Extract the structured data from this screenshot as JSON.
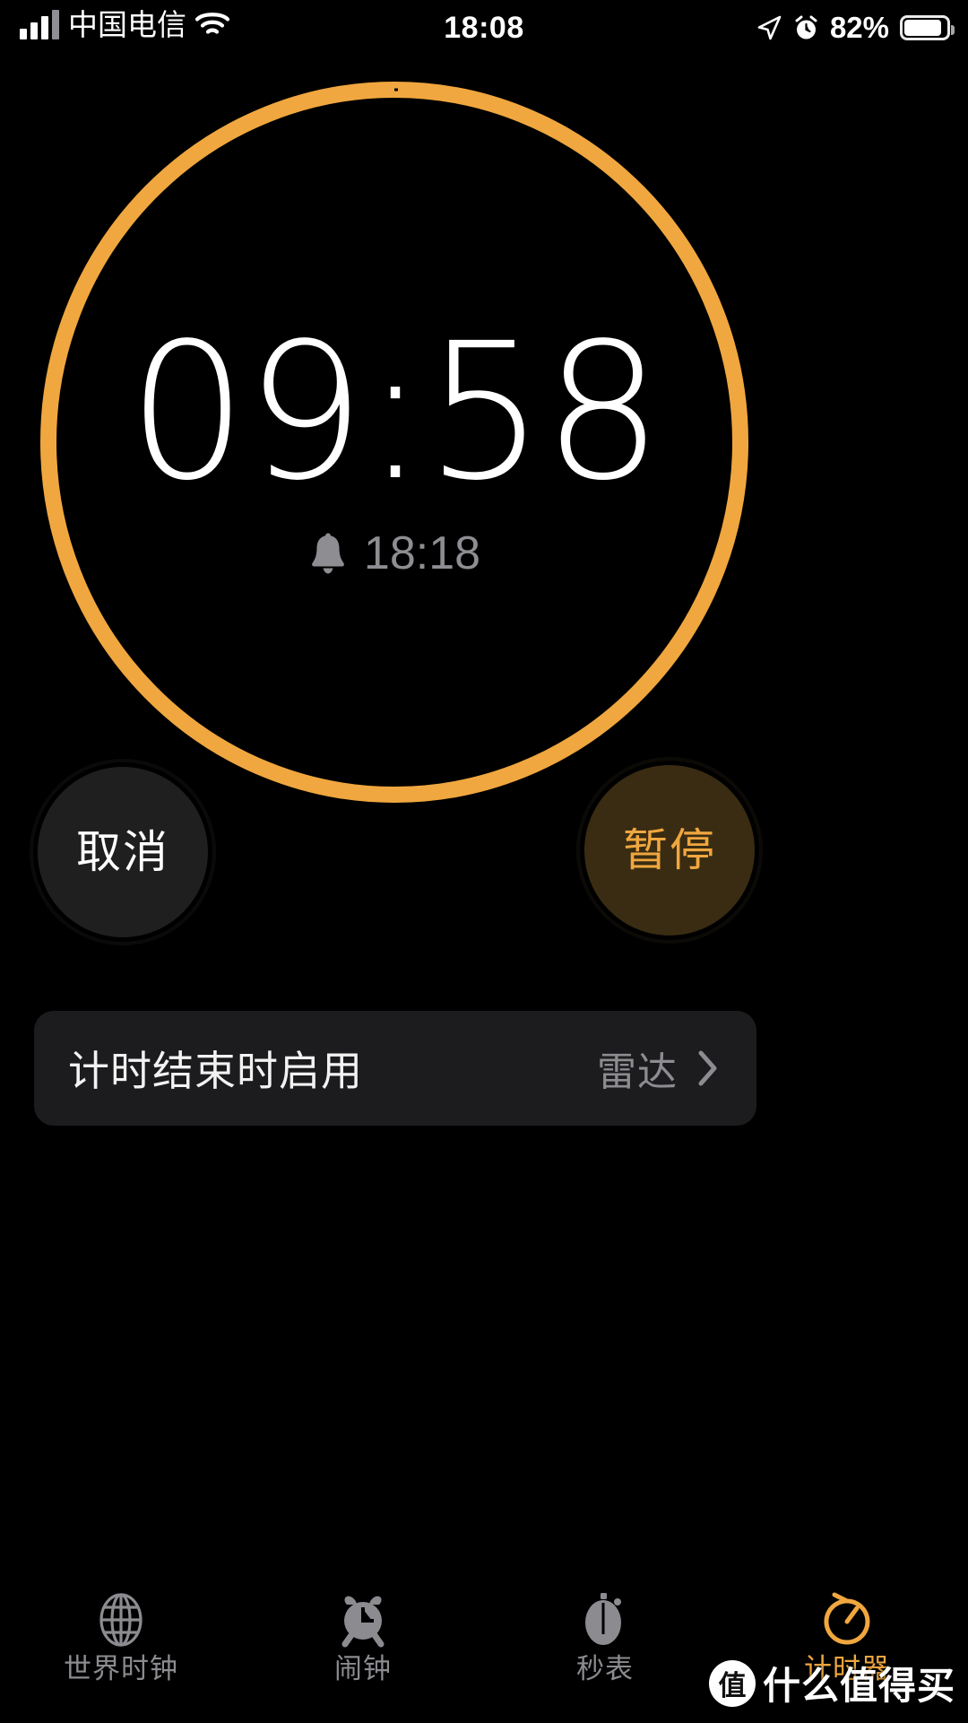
{
  "status_bar": {
    "carrier": "中国电信",
    "time": "18:08",
    "battery_percent": "82%",
    "battery_level": 82,
    "signal_icon": "signal-bars-icon",
    "wifi_icon": "wifi-icon",
    "location_icon": "location-arrow-icon",
    "alarm_icon": "alarm-clock-icon"
  },
  "timer": {
    "remaining": "09:58",
    "ends_at": "18:18",
    "bell_icon": "bell-icon",
    "ring_color": "#f0a73f",
    "ring_progress_percent": 99.7,
    "state": "running"
  },
  "buttons": {
    "cancel": {
      "label": "取消",
      "text_color": "#ffffff",
      "fill_color": "#1f1f1f"
    },
    "pause": {
      "label": "暂停",
      "text_color": "#f0a73f",
      "fill_color": "#3a2c12"
    }
  },
  "settings_row": {
    "label": "计时结束时启用",
    "value": "雷达",
    "chevron_icon": "chevron-right-icon"
  },
  "tab_bar": {
    "items": [
      {
        "label": "世界时钟",
        "icon": "globe-icon",
        "active": false
      },
      {
        "label": "闹钟",
        "icon": "alarm-clock-icon",
        "active": false
      },
      {
        "label": "秒表",
        "icon": "stopwatch-icon",
        "active": false
      },
      {
        "label": "计时器",
        "icon": "timer-icon",
        "active": true
      }
    ],
    "inactive_color": "#8b8b90",
    "active_color": "#f0a73f"
  },
  "watermark": {
    "badge": "值",
    "text": "什么值得买"
  }
}
